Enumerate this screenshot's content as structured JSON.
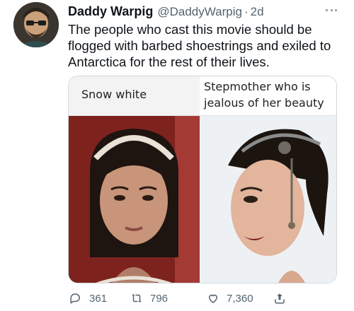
{
  "tweet": {
    "display_name": "Daddy Warpig",
    "handle": "@DaddyWarpig",
    "separator": "·",
    "time": "2d",
    "text": "The people who cast this movie should be flogged with barbed shoestrings and exiled to Antarctica for the rest of their lives."
  },
  "media": {
    "left_caption": "Snow white",
    "right_caption": "Stepmother who is jealous of her beauty"
  },
  "actions": {
    "replies": "361",
    "retweets": "796",
    "likes": "7,360"
  },
  "icons": {
    "reply": "reply-icon",
    "retweet": "retweet-icon",
    "like": "heart-icon",
    "share": "share-icon",
    "more": "more-icon"
  },
  "colors": {
    "text_primary": "#0f1419",
    "text_secondary": "#536471",
    "border": "#cfd9de"
  }
}
